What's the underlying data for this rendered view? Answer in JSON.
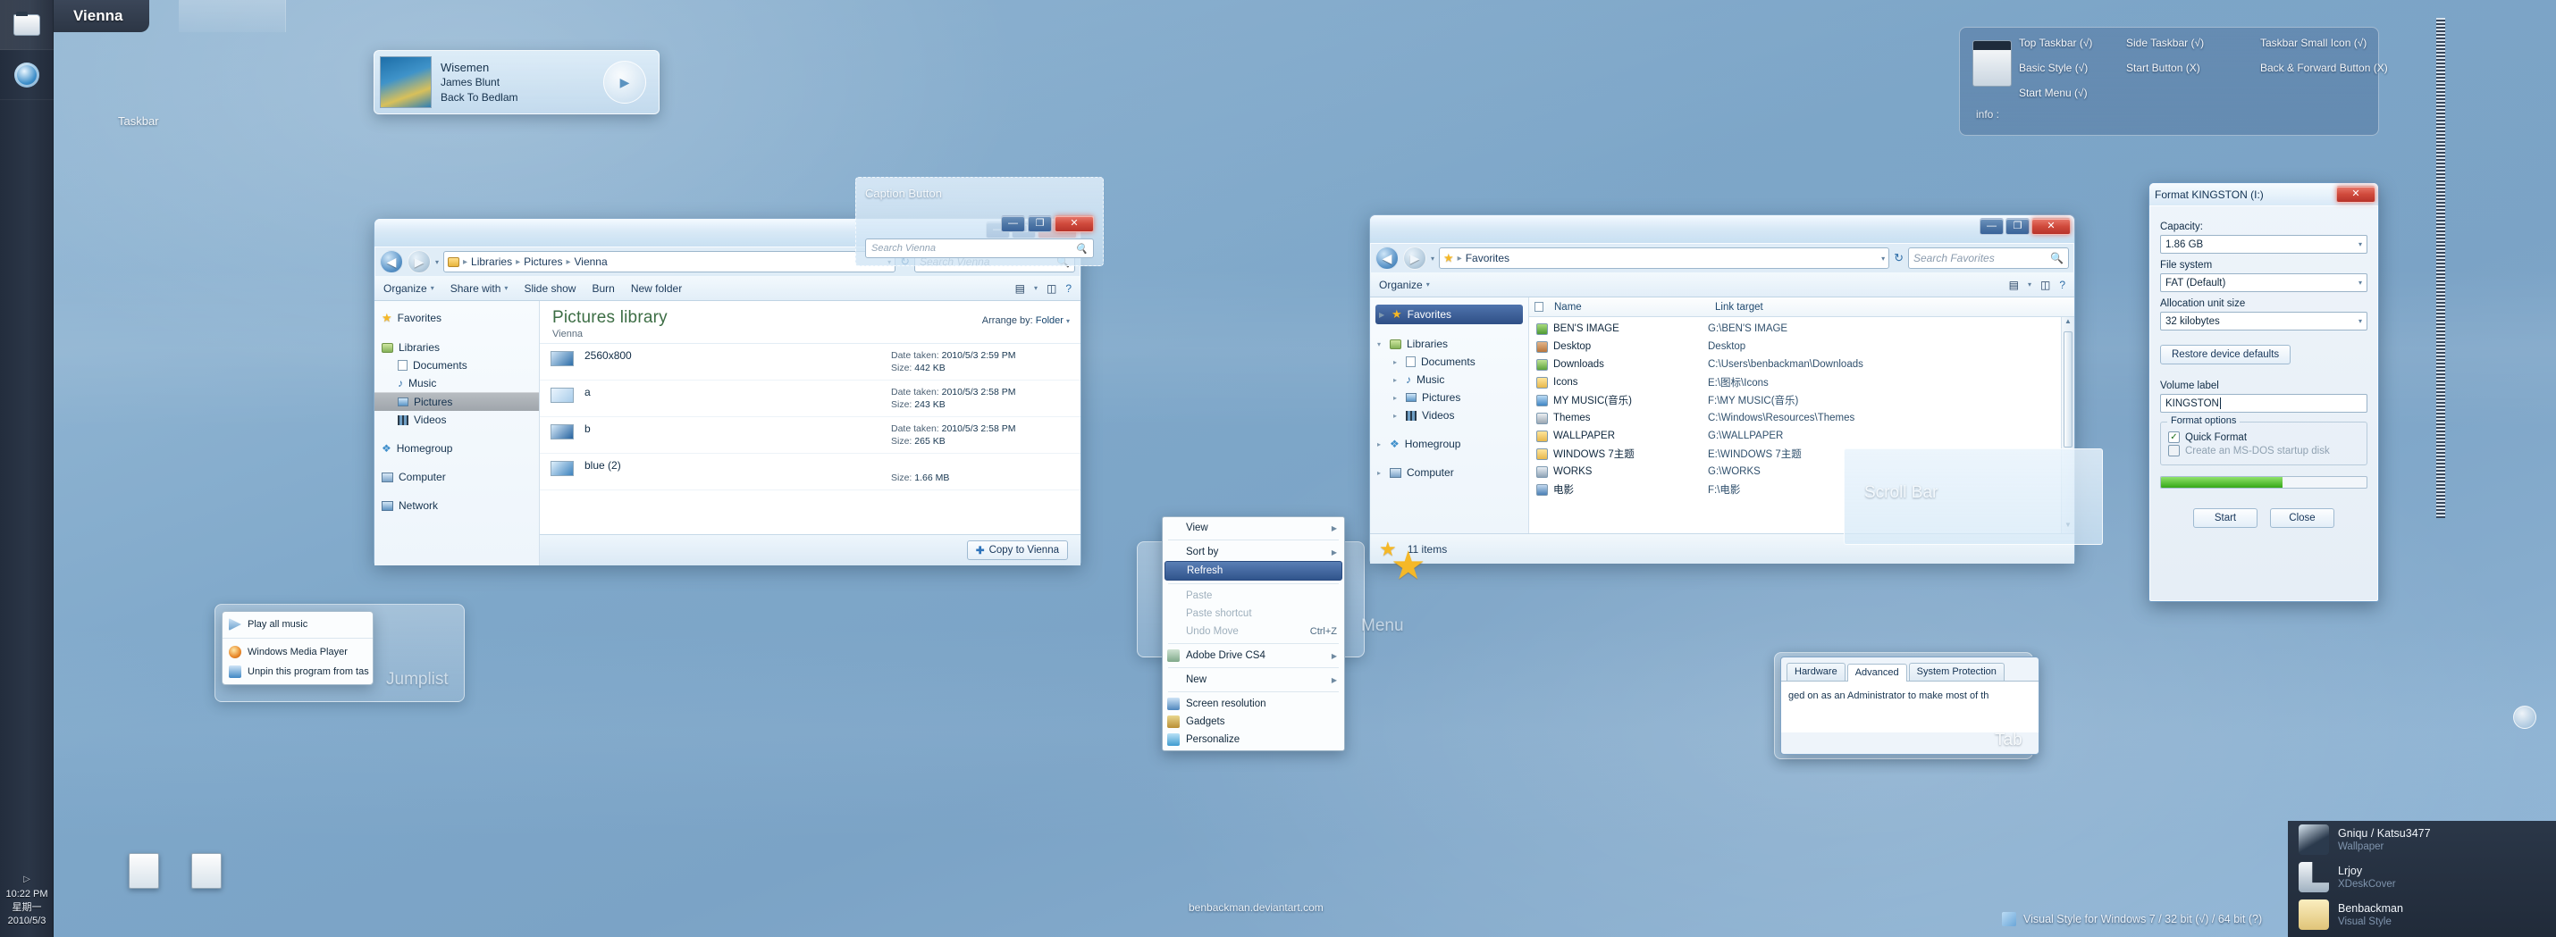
{
  "desktop": {
    "start_tab_label": "Vienna",
    "taskbar_label": "Taskbar",
    "jumplist_label": "Jumplist",
    "menu_label": "Menu",
    "tab_label": "Tab",
    "scrollbar_label": "Scroll Bar",
    "watermark": "benbackman.deviantart.com",
    "bottom_note": "Visual Style for Windows 7  / 32 bit (√) / 64 bit (?)",
    "clock": {
      "tray_arrow": "▷",
      "time": "10:22 PM",
      "weekday": "星期一",
      "date": "2010/5/3"
    }
  },
  "info_panel": {
    "info_label": "info :",
    "entries": [
      "Top Taskbar (√)",
      "Side Taskbar (√)",
      "Taskbar Small Icon (√)",
      "Basic Style (√)",
      "Start Button (X)",
      "Back & Forward Button (X)",
      "Start Menu (√)"
    ]
  },
  "media_preview": {
    "title": "Wisemen",
    "artist": "James Blunt",
    "album": "Back To Bedlam",
    "play_icon": "play-icon"
  },
  "caption_demo": {
    "label": "Caption Button",
    "minimize": "—",
    "maximize": "❐",
    "close": "✕",
    "search_placeholder": "Search Vienna"
  },
  "pictures_window": {
    "back_icon": "◀",
    "forward_icon": "▶",
    "breadcrumb": [
      "Libraries",
      "Pictures",
      "Vienna"
    ],
    "search_placeholder": "Search Vienna",
    "caption": {
      "minimize": "—",
      "maximize": "❐",
      "close": "✕"
    },
    "toolbar": [
      "Organize",
      "Share with",
      "Slide show",
      "Burn",
      "New folder"
    ],
    "nav": {
      "favorites": "Favorites",
      "libraries": "Libraries",
      "children": [
        "Documents",
        "Music",
        "Pictures",
        "Videos"
      ],
      "homegroup": "Homegroup",
      "computer": "Computer",
      "network": "Network",
      "selected": "Pictures"
    },
    "header_title": "Pictures library",
    "header_sub": "Vienna",
    "arrange_label": "Arrange by:",
    "arrange_value": "Folder",
    "files": [
      {
        "name": "2560x800",
        "date_label": "Date taken:",
        "date": "2010/5/3 2:59 PM",
        "size_label": "Size:",
        "size": "442 KB"
      },
      {
        "name": "a",
        "date_label": "Date taken:",
        "date": "2010/5/3 2:58 PM",
        "size_label": "Size:",
        "size": "243 KB"
      },
      {
        "name": "b",
        "date_label": "Date taken:",
        "date": "2010/5/3 2:58 PM",
        "size_label": "Size:",
        "size": "265 KB"
      },
      {
        "name": "blue (2)",
        "date_label": "",
        "date": "",
        "size_label": "Size:",
        "size": "1.66 MB"
      }
    ],
    "copy_button": "Copy to Vienna"
  },
  "favorites_window": {
    "breadcrumb": [
      "Favorites"
    ],
    "search_placeholder": "Search Favorites",
    "caption": {
      "minimize": "—",
      "maximize": "❐",
      "close": "✕"
    },
    "toolbar": [
      "Organize"
    ],
    "nav": {
      "favorites": "Favorites",
      "libraries": "Libraries",
      "children": [
        "Documents",
        "Music",
        "Pictures",
        "Videos"
      ],
      "homegroup": "Homegroup",
      "computer": "Computer"
    },
    "columns": [
      "Name",
      "Link target"
    ],
    "rows": [
      {
        "name": "BEN'S IMAGE",
        "target": "G:\\BEN'S IMAGE"
      },
      {
        "name": "Desktop",
        "target": "Desktop"
      },
      {
        "name": "Downloads",
        "target": "C:\\Users\\benbackman\\Downloads"
      },
      {
        "name": "Icons",
        "target": "E:\\图标\\Icons"
      },
      {
        "name": "MY MUSIC(音乐)",
        "target": "F:\\MY MUSIC(音乐)"
      },
      {
        "name": "Themes",
        "target": "C:\\Windows\\Resources\\Themes"
      },
      {
        "name": "WALLPAPER",
        "target": "G:\\WALLPAPER"
      },
      {
        "name": "WINDOWS 7主题",
        "target": "E:\\WINDOWS 7主题"
      },
      {
        "name": "WORKS",
        "target": "G:\\WORKS"
      },
      {
        "name": "电影",
        "target": "F:\\电影"
      }
    ],
    "status": "11 items"
  },
  "format_dialog": {
    "title": "Format KINGSTON (I:)",
    "close": "✕",
    "capacity_label": "Capacity:",
    "capacity_value": "1.86 GB",
    "filesystem_label": "File system",
    "filesystem_value": "FAT (Default)",
    "allocation_label": "Allocation unit size",
    "allocation_value": "32 kilobytes",
    "restore_button": "Restore device defaults",
    "volume_label": "Volume label",
    "volume_value": "KINGSTON",
    "options_legend": "Format options",
    "quick_format": "Quick Format",
    "msdos": "Create an MS-DOS startup disk",
    "progress_percent": 59,
    "start_button": "Start",
    "close_button": "Close"
  },
  "context_menu": {
    "items": [
      {
        "label": "View",
        "submenu": "▶",
        "state": "normal",
        "icon": ""
      },
      {
        "label": "Sort by",
        "submenu": "▶",
        "state": "normal",
        "icon": ""
      },
      {
        "label": "Refresh",
        "submenu": "",
        "state": "selected",
        "icon": ""
      },
      {
        "label": "Paste",
        "submenu": "",
        "state": "disabled",
        "icon": ""
      },
      {
        "label": "Paste shortcut",
        "submenu": "",
        "state": "disabled",
        "icon": ""
      },
      {
        "label": "Undo Move",
        "submenu": "",
        "state": "disabled",
        "accel": "Ctrl+Z",
        "icon": ""
      },
      {
        "label": "Adobe Drive CS4",
        "submenu": "▶",
        "state": "normal",
        "icon": "adobe-drive-icon"
      },
      {
        "label": "New",
        "submenu": "▶",
        "state": "normal",
        "icon": ""
      },
      {
        "label": "Screen resolution",
        "submenu": "",
        "state": "normal",
        "icon": "monitor-icon"
      },
      {
        "label": "Gadgets",
        "submenu": "",
        "state": "normal",
        "icon": "gadgets-icon"
      },
      {
        "label": "Personalize",
        "submenu": "",
        "state": "normal",
        "icon": "personalize-icon"
      }
    ]
  },
  "jumplist": {
    "items": [
      {
        "label": "Play all music",
        "icon": "play-icon"
      },
      {
        "label": "Windows Media Player",
        "icon": "wmp-icon"
      },
      {
        "label": "Unpin this program from tas",
        "icon": "unpin-icon"
      }
    ]
  },
  "system_properties": {
    "tabs": [
      "Hardware",
      "Advanced",
      "System Protection"
    ],
    "active_tab": "Advanced",
    "body_text": "ged on as an Administrator to make most of th"
  },
  "credits": [
    {
      "name": "Gniqu / Katsu3477",
      "role": "Wallpaper",
      "icon": "anime-avatar-icon"
    },
    {
      "name": "Lrjoy",
      "role": "XDeskCover",
      "icon": "l-block-icon"
    },
    {
      "name": "Benbackman",
      "role": "Visual Style",
      "icon": "teddy-bear-icon"
    }
  ],
  "colors": {
    "accent": "#2f6ea8",
    "taskbar": "#2b3647",
    "close_red": "#d04a3c",
    "progress_green": "#35a818",
    "library_green": "#3c6d44"
  }
}
